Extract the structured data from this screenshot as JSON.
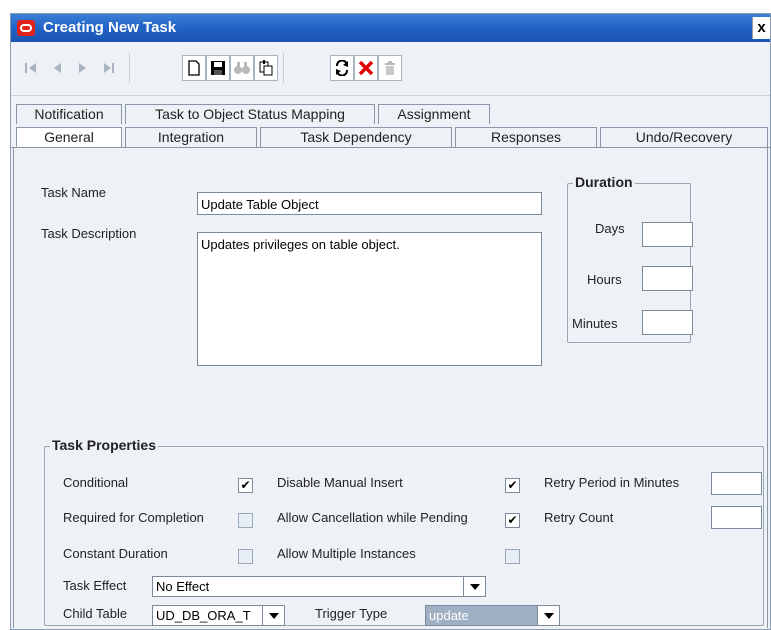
{
  "window": {
    "title": "Creating New Task",
    "close_glyph": "x"
  },
  "toolbar": {
    "icons": [
      "first-record-icon",
      "previous-record-icon",
      "next-record-icon",
      "last-record-icon",
      "new-icon",
      "save-icon",
      "find-icon",
      "query-icon",
      "refresh-icon",
      "delete-icon",
      "trash-icon"
    ]
  },
  "tabs_row1": [
    "Notification",
    "Task to Object Status Mapping",
    "Assignment"
  ],
  "tabs_row2": [
    "General",
    "Integration",
    "Task Dependency",
    "Responses",
    "Undo/Recovery"
  ],
  "active_tab": "General",
  "general": {
    "task_name_label": "Task Name",
    "task_name_value": "Update Table Object",
    "task_description_label": "Task Description",
    "task_description_value": "Updates privileges on table object.",
    "duration": {
      "legend": "Duration",
      "days_label": "Days",
      "hours_label": "Hours",
      "minutes_label": "Minutes",
      "days_value": "",
      "hours_value": "",
      "minutes_value": ""
    }
  },
  "task_properties": {
    "legend": "Task Properties",
    "conditional_label": "Conditional",
    "conditional_checked": true,
    "required_label": "Required for Completion",
    "required_checked": false,
    "constant_duration_label": "Constant Duration",
    "constant_duration_checked": false,
    "disable_manual_insert_label": "Disable Manual Insert",
    "disable_manual_insert_checked": true,
    "allow_cancellation_label": "Allow Cancellation while Pending",
    "allow_cancellation_checked": true,
    "allow_multiple_label": "Allow Multiple Instances",
    "allow_multiple_checked": false,
    "retry_period_label": "Retry Period in Minutes",
    "retry_period_value": "",
    "retry_count_label": "Retry Count",
    "retry_count_value": "",
    "task_effect_label": "Task Effect",
    "task_effect_value": "No Effect",
    "child_table_label": "Child Table",
    "child_table_value": "UD_DB_ORA_T",
    "trigger_type_label": "Trigger Type",
    "trigger_type_value": "update"
  },
  "check_glyph": "✔"
}
